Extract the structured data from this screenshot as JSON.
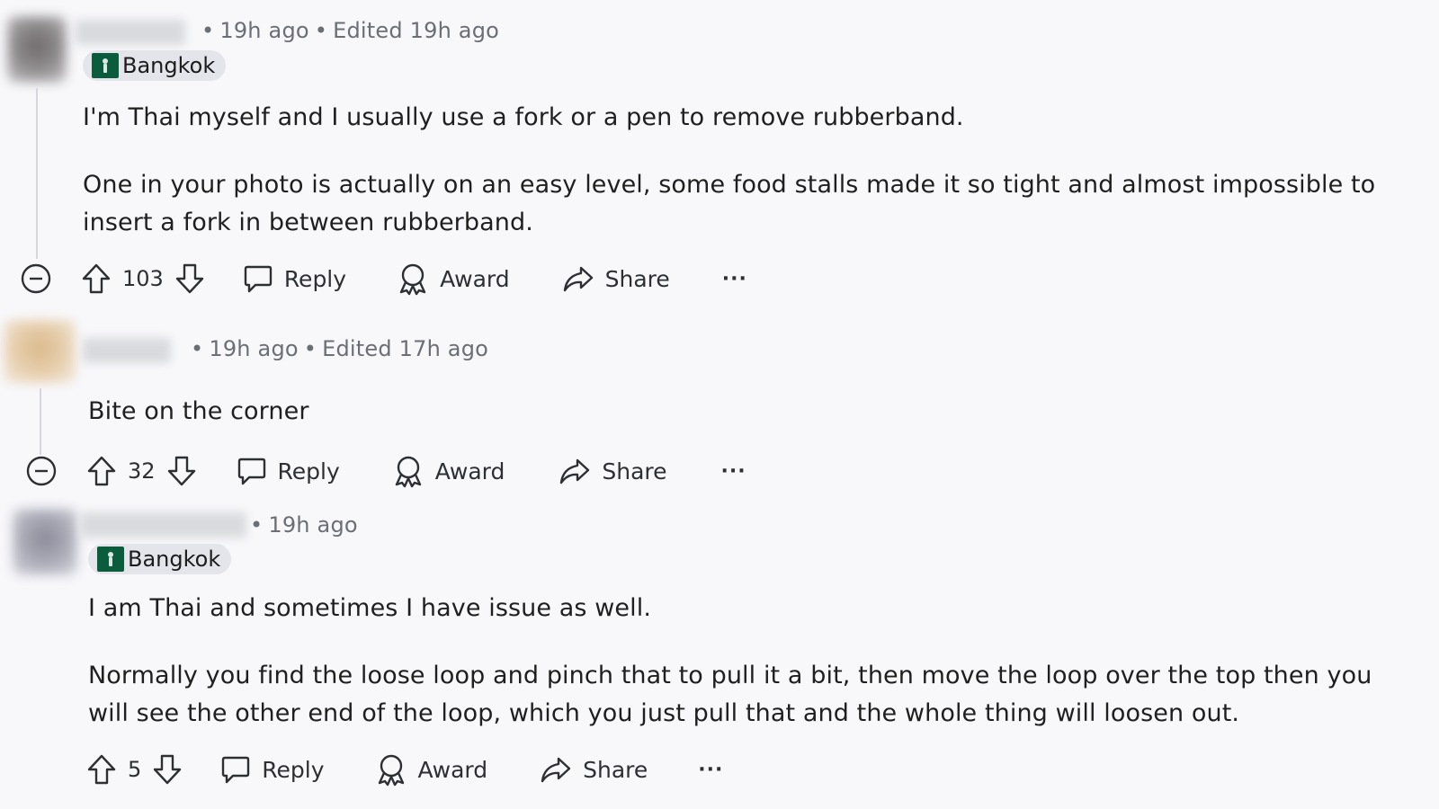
{
  "comments": [
    {
      "meta": {
        "time": "19h ago",
        "edited": "Edited 19h ago"
      },
      "flair": {
        "label": "Bangkok"
      },
      "paragraphs": [
        "I'm Thai myself and I usually use a fork or a pen to remove rubberband.",
        "One in your photo is actually on an easy level, some food stalls made it so tight and almost impossible to insert a fork in between rubberband."
      ],
      "actions": {
        "score": "103",
        "reply": "Reply",
        "award": "Award",
        "share": "Share",
        "more": "···"
      },
      "icons": [
        "collapse-icon",
        "upvote-icon",
        "downvote-icon",
        "comment-icon",
        "award-icon",
        "share-icon",
        "more-icon"
      ]
    },
    {
      "meta": {
        "time": "19h ago",
        "edited": "Edited 17h ago"
      },
      "paragraphs": [
        "Bite on the corner"
      ],
      "actions": {
        "score": "32",
        "reply": "Reply",
        "award": "Award",
        "share": "Share",
        "more": "···"
      }
    },
    {
      "meta": {
        "time": "19h ago"
      },
      "flair": {
        "label": "Bangkok"
      },
      "paragraphs": [
        "I am Thai and sometimes I have issue as well.",
        "Normally you find the loose loop and pinch that to pull it a bit, then move the loop over the top then you will see the other end of the loop, which you just pull that and the whole thing will loosen out."
      ],
      "actions": {
        "score": "5",
        "reply": "Reply",
        "award": "Award",
        "share": "Share",
        "more": "···"
      }
    }
  ],
  "colors": {
    "background": "#f8f8fb",
    "flair_bg": "#e4e5ea",
    "flair_badge": "#0a5c3c",
    "meta_text": "#6b6e74"
  }
}
